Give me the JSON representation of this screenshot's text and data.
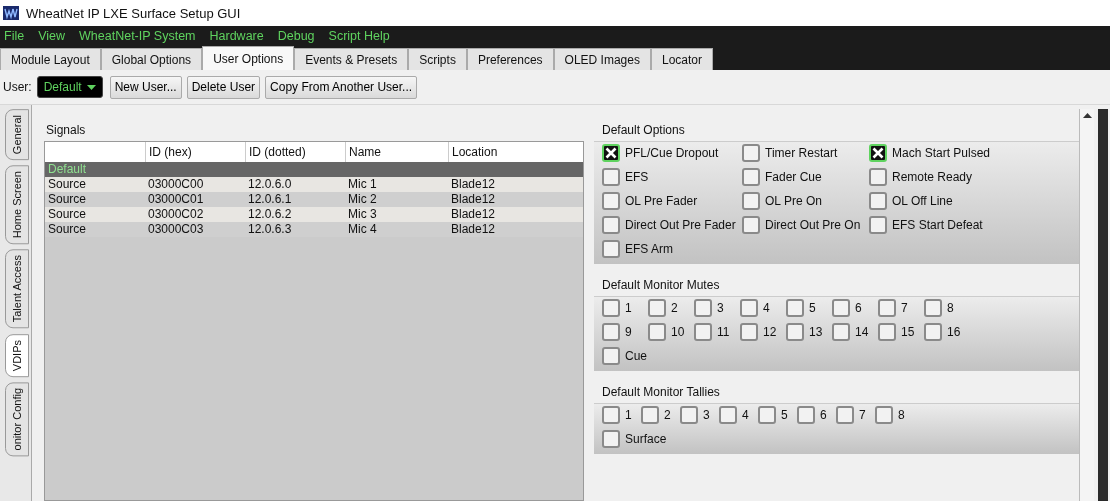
{
  "window": {
    "title": "WheatNet IP LXE Surface Setup GUI"
  },
  "menu": [
    {
      "label": "File"
    },
    {
      "label": "View"
    },
    {
      "label": "WheatNet-IP System"
    },
    {
      "label": "Hardware"
    },
    {
      "label": "Debug"
    },
    {
      "label": "Script Help"
    }
  ],
  "tabs": [
    {
      "label": "Module Layout",
      "selected": false
    },
    {
      "label": "Global Options",
      "selected": false
    },
    {
      "label": "User Options",
      "selected": true
    },
    {
      "label": "Events & Presets",
      "selected": false
    },
    {
      "label": "Scripts",
      "selected": false
    },
    {
      "label": "Preferences",
      "selected": false
    },
    {
      "label": "OLED Images",
      "selected": false
    },
    {
      "label": "Locator",
      "selected": false
    }
  ],
  "user": {
    "label": "User:",
    "value": "Default"
  },
  "buttons": [
    {
      "label": "New User..."
    },
    {
      "label": "Delete User"
    },
    {
      "label": "Copy From Another User..."
    }
  ],
  "side_tabs": [
    {
      "label": "General",
      "selected": false
    },
    {
      "label": "Home Screen",
      "selected": false
    },
    {
      "label": "Talent Access",
      "selected": false
    },
    {
      "label": "VDIPs",
      "selected": true
    },
    {
      "label": "onitor Config",
      "selected": false
    }
  ],
  "signals": {
    "title": "Signals",
    "columns": [
      "ID (hex)",
      "ID (dotted)",
      "Name",
      "Location"
    ],
    "groups": [
      {
        "name": "Default",
        "rows": [
          [
            "Source",
            "03000C00",
            "12.0.6.0",
            "Mic 1",
            "Blade12"
          ],
          [
            "Source",
            "03000C01",
            "12.0.6.1",
            "Mic 2",
            "Blade12"
          ],
          [
            "Source",
            "03000C02",
            "12.0.6.2",
            "Mic 3",
            "Blade12"
          ],
          [
            "Source",
            "03000C03",
            "12.0.6.3",
            "Mic 4",
            "Blade12"
          ]
        ]
      }
    ]
  },
  "groups": [
    {
      "title": "Default Options",
      "kind": "options",
      "rows": [
        [
          {
            "label": "PFL/Cue Dropout",
            "checked": true
          },
          {
            "label": "Timer Restart",
            "checked": false
          },
          {
            "label": "Mach Start Pulsed",
            "checked": true
          }
        ],
        [
          {
            "label": "EFS",
            "checked": false
          },
          {
            "label": "Fader Cue",
            "checked": false
          },
          {
            "label": "Remote Ready",
            "checked": false
          }
        ],
        [
          {
            "label": "OL Pre Fader",
            "checked": false
          },
          {
            "label": "OL Pre On",
            "checked": false
          },
          {
            "label": "OL Off Line",
            "checked": false
          }
        ],
        [
          {
            "label": "Direct Out Pre Fader",
            "checked": false
          },
          {
            "label": "Direct Out Pre On",
            "checked": false
          },
          {
            "label": "EFS Start Defeat",
            "checked": false
          }
        ],
        [
          {
            "label": "EFS Arm",
            "checked": false
          }
        ]
      ]
    },
    {
      "title": "Default Monitor Mutes",
      "kind": "mutes",
      "rows": [
        [
          {
            "label": "1",
            "checked": false
          },
          {
            "label": "2",
            "checked": false
          },
          {
            "label": "3",
            "checked": false
          },
          {
            "label": "4",
            "checked": false
          },
          {
            "label": "5",
            "checked": false
          },
          {
            "label": "6",
            "checked": false
          },
          {
            "label": "7",
            "checked": false
          },
          {
            "label": "8",
            "checked": false
          }
        ],
        [
          {
            "label": "9",
            "checked": false
          },
          {
            "label": "10",
            "checked": false
          },
          {
            "label": "11",
            "checked": false
          },
          {
            "label": "12",
            "checked": false
          },
          {
            "label": "13",
            "checked": false
          },
          {
            "label": "14",
            "checked": false
          },
          {
            "label": "15",
            "checked": false
          },
          {
            "label": "16",
            "checked": false
          }
        ],
        [
          {
            "label": "Cue",
            "checked": false
          }
        ]
      ]
    },
    {
      "title": "Default Monitor Tallies",
      "kind": "tallies",
      "rows": [
        [
          {
            "label": "1",
            "checked": false
          },
          {
            "label": "2",
            "checked": false
          },
          {
            "label": "3",
            "checked": false
          },
          {
            "label": "4",
            "checked": false
          },
          {
            "label": "5",
            "checked": false
          },
          {
            "label": "6",
            "checked": false
          },
          {
            "label": "7",
            "checked": false
          },
          {
            "label": "8",
            "checked": false
          }
        ],
        [
          {
            "label": "Surface",
            "checked": false
          }
        ]
      ]
    }
  ]
}
